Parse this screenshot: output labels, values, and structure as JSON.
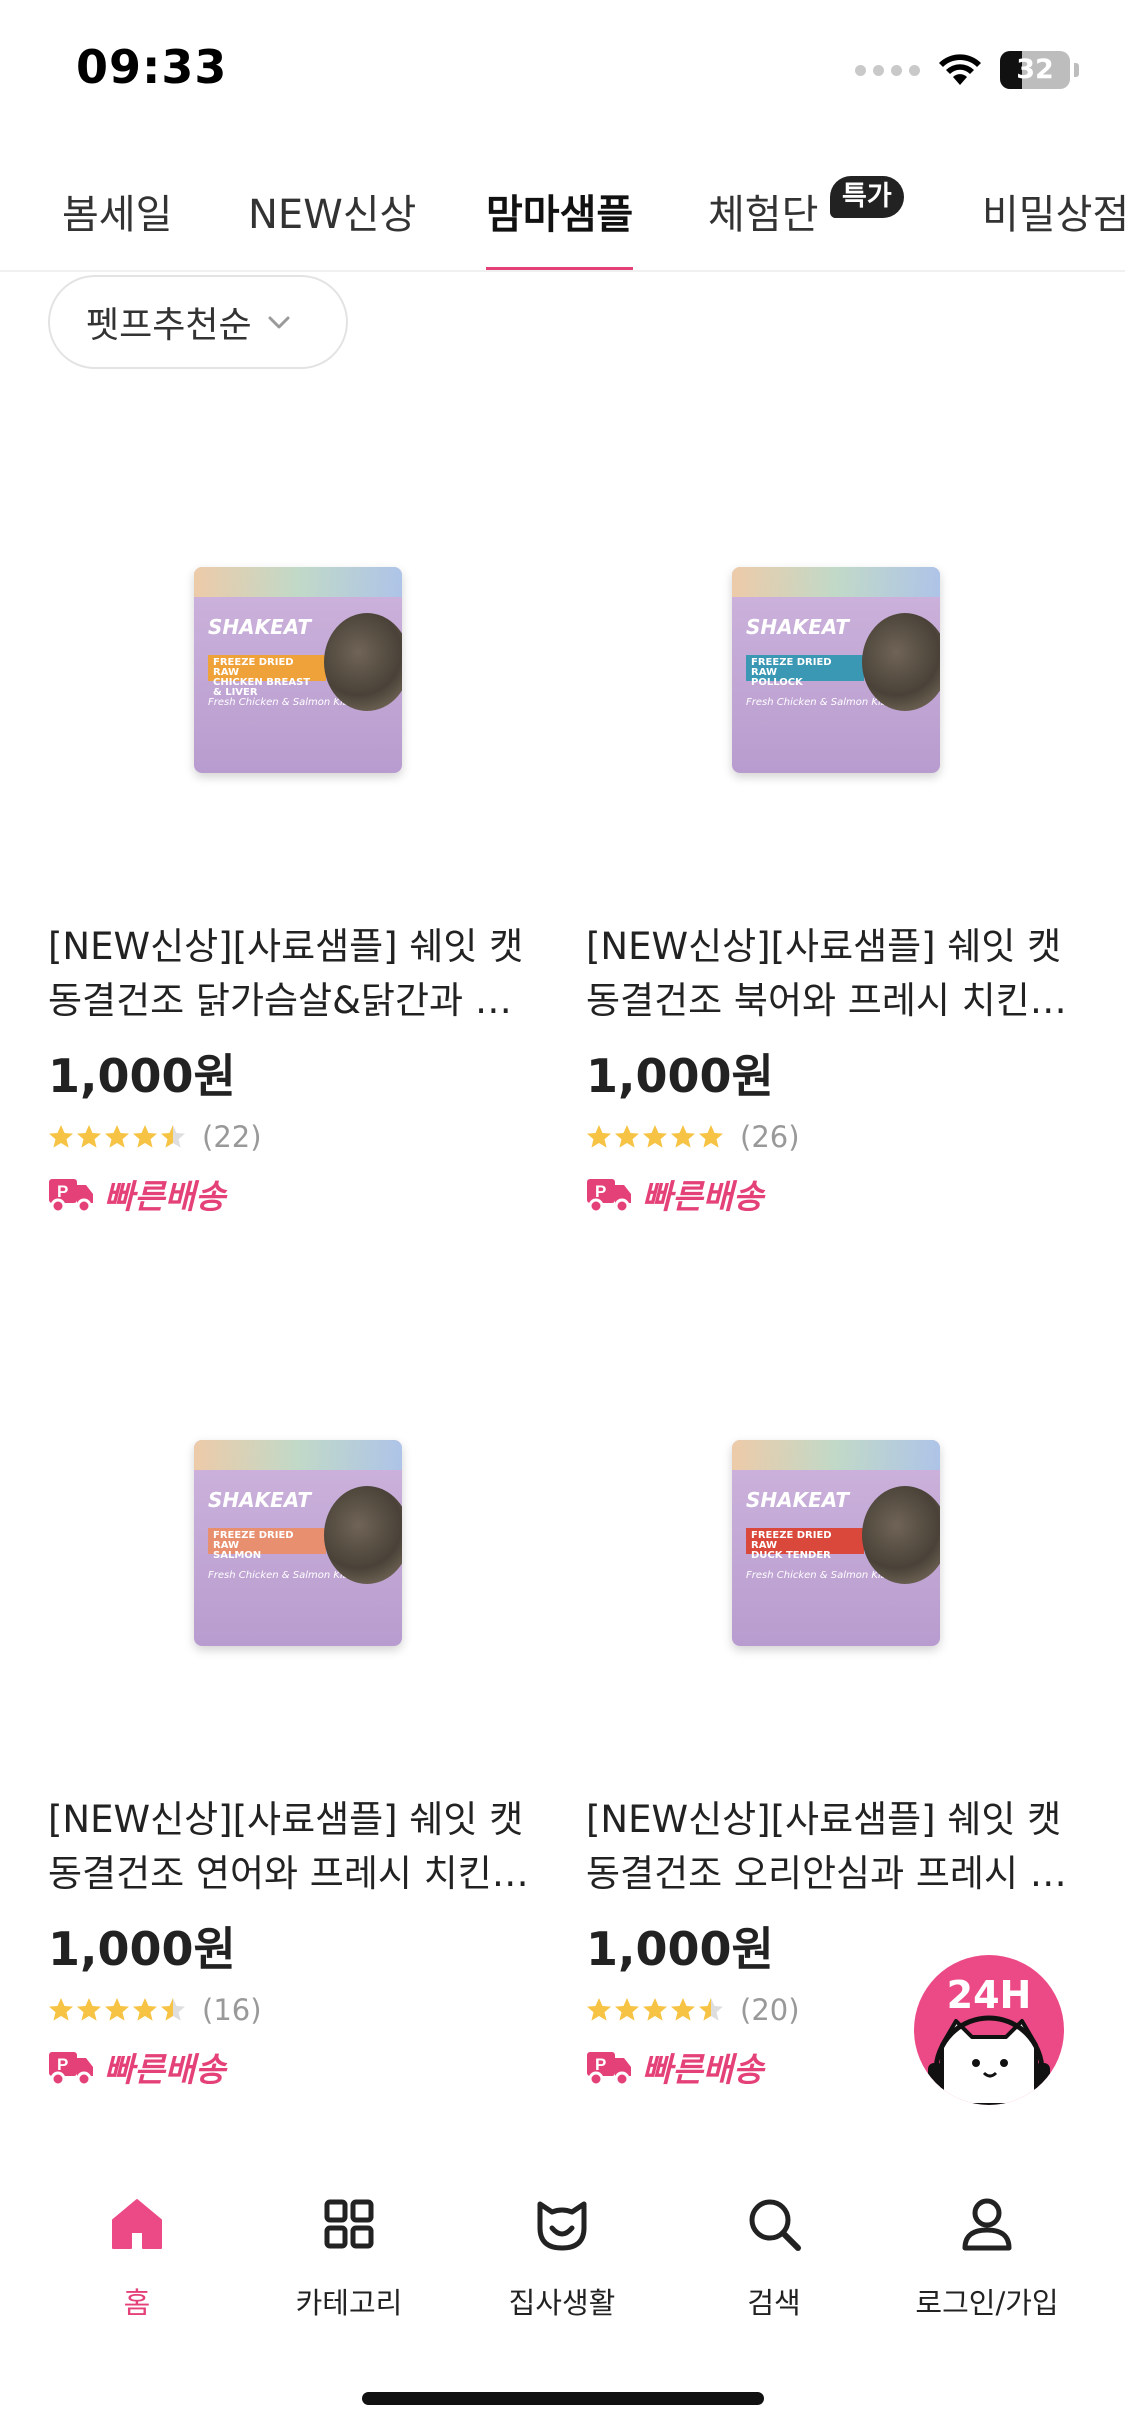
{
  "status_bar": {
    "time": "09:33",
    "battery": "32",
    "battery_level": 0.32
  },
  "tabs": [
    {
      "label": "봄세일",
      "active": false
    },
    {
      "label": "NEW신상",
      "active": false
    },
    {
      "label": "맘마샘플",
      "active": true
    },
    {
      "label": "체험단",
      "active": false,
      "badge": "특가"
    },
    {
      "label": "비밀상점",
      "active": false
    }
  ],
  "sort": {
    "label": "펫프추천순",
    "icon": "chevron-down-icon"
  },
  "products": [
    {
      "title_line1": "[NEW신상][사료샘플] 쉐잇 캣",
      "title_line2": "동결건조 닭가슴살&닭간과 프레시 치킨",
      "price": "1,000원",
      "rating": 4.5,
      "reviews": "(22)",
      "delivery": "빠른배송",
      "package": {
        "brand": "SHAKEAT",
        "strip_line1": "FREEZE DRIED RAW",
        "strip_line2": "CHICKEN BREAST & LIVER",
        "strip_color": "#f0a23a",
        "sub": "Fresh Chicken & Salmon Kibble"
      }
    },
    {
      "title_line1": "[NEW신상][사료샘플] 쉐잇 캣",
      "title_line2": "동결건조 북어와 프레시 치킨&연어",
      "price": "1,000원",
      "rating": 5,
      "reviews": "(26)",
      "delivery": "빠른배송",
      "package": {
        "brand": "SHAKEAT",
        "strip_line1": "FREEZE DRIED RAW",
        "strip_line2": "POLLOCK",
        "strip_color": "#3a98b5",
        "sub": "Fresh Chicken & Salmon Kibble"
      }
    },
    {
      "title_line1": "[NEW신상][사료샘플] 쉐잇 캣",
      "title_line2": "동결건조 연어와 프레시 치킨&연어",
      "price": "1,000원",
      "rating": 4.5,
      "reviews": "(16)",
      "delivery": "빠른배송",
      "package": {
        "brand": "SHAKEAT",
        "strip_line1": "FREEZE DRIED RAW",
        "strip_line2": "SALMON",
        "strip_color": "#e88f6f",
        "sub": "Fresh Chicken & Salmon Kibble"
      }
    },
    {
      "title_line1": "[NEW신상][사료샘플] 쉐잇 캣",
      "title_line2": "동결건조 오리안심과 프레시 치킨",
      "price": "1,000원",
      "rating": 4.5,
      "reviews": "(20)",
      "delivery": "빠른배송",
      "package": {
        "brand": "SHAKEAT",
        "strip_line1": "FREEZE DRIED RAW",
        "strip_line2": "DUCK TENDER",
        "strip_color": "#d9483b",
        "sub": "Fresh Chicken & Salmon Kibble"
      }
    }
  ],
  "chat": {
    "label": "24H"
  },
  "bottom_nav": [
    {
      "label": "홈",
      "icon": "home-icon",
      "active": true
    },
    {
      "label": "카테고리",
      "icon": "grid-icon",
      "active": false
    },
    {
      "label": "집사생활",
      "icon": "cat-face-icon",
      "active": false
    },
    {
      "label": "검색",
      "icon": "search-icon",
      "active": false
    },
    {
      "label": "로그인/가입",
      "icon": "user-icon",
      "active": false
    }
  ],
  "colors": {
    "accent": "#e54179",
    "star": "#f6c344",
    "chat": "#ec4a86"
  }
}
